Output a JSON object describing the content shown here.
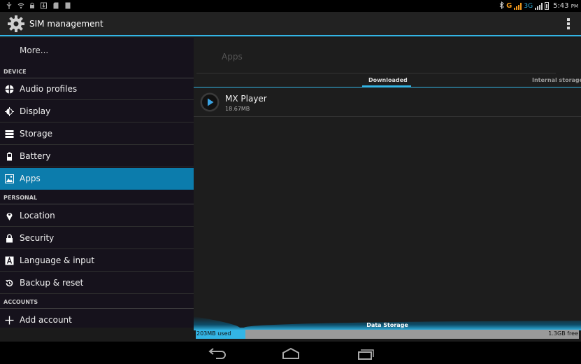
{
  "status_bar": {
    "time": "5:43",
    "ampm": "PM",
    "network_g": "G",
    "network_3g": "3G",
    "colors": {
      "signal": "#f39a1c",
      "icons": "#aaaaaa"
    },
    "left_icons": [
      "usb-icon",
      "wifi-icon",
      "lock-notification-icon",
      "download-icon",
      "sd-card-icon",
      "sd-card-icon"
    ],
    "right_icons": [
      "bluetooth-icon",
      "signal-icon",
      "battery-icon"
    ]
  },
  "action_bar": {
    "title": "SIM management",
    "icon": "settings-gear-icon",
    "overflow_icon": "overflow-menu-icon",
    "accent": "#33b5e5"
  },
  "left_pane": {
    "more_label": "More...",
    "sections": {
      "device": "DEVICE",
      "personal": "PERSONAL",
      "accounts": "ACCOUNTS"
    },
    "items": [
      {
        "label": "Audio profiles",
        "icon": "audio-profiles-icon"
      },
      {
        "label": "Display",
        "icon": "display-brightness-icon"
      },
      {
        "label": "Storage",
        "icon": "storage-icon"
      },
      {
        "label": "Battery",
        "icon": "battery-icon"
      },
      {
        "label": "Apps",
        "icon": "apps-icon",
        "selected": true
      },
      {
        "label": "Location",
        "icon": "location-pin-icon"
      },
      {
        "label": "Security",
        "icon": "lock-icon"
      },
      {
        "label": "Language & input",
        "icon": "language-icon"
      },
      {
        "label": "Backup & reset",
        "icon": "backup-reset-icon"
      },
      {
        "label": "Add account",
        "icon": "plus-icon"
      }
    ],
    "selected_color": "#0c7cac"
  },
  "right_pane": {
    "heading": "Apps",
    "tabs": [
      {
        "label": "Downloaded",
        "active": true
      },
      {
        "label": "Internal storage",
        "active": false
      }
    ],
    "apps": [
      {
        "name": "MX Player",
        "size": "18.67MB",
        "icon": "mx-player-icon"
      }
    ]
  },
  "storage": {
    "label": "Data Storage",
    "used": "203MB used",
    "free": "1.3GB free",
    "used_fraction": 0.13,
    "used_color": "#33b5e5",
    "free_color": "#9a9a9a"
  },
  "nav_bar": {
    "buttons": [
      "back-icon",
      "home-icon",
      "recent-apps-icon"
    ]
  }
}
